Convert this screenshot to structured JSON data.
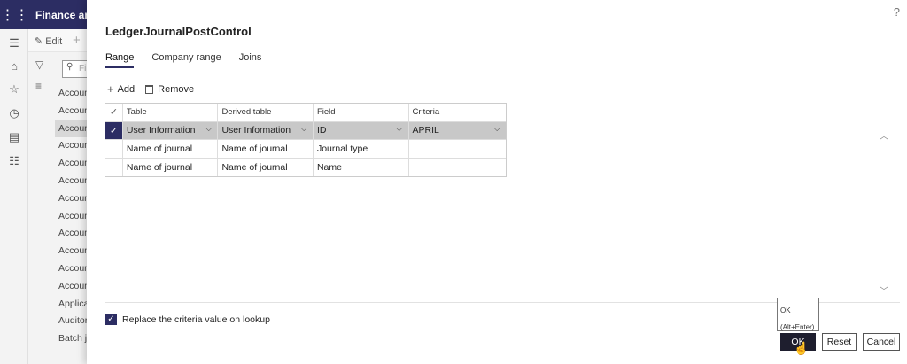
{
  "app": {
    "title": "Finance and"
  },
  "background": {
    "edit_label": "Edit",
    "filter_placeholder": "Fi",
    "list_items": [
      "Account",
      "Account",
      "Account",
      "Account",
      "Account",
      "Account",
      "Account",
      "Account",
      "Account",
      "Account",
      "Account",
      "Account",
      "Applica",
      "Auditor",
      "Batch jo"
    ]
  },
  "dialog": {
    "title": "LedgerJournalPostControl",
    "help": "?",
    "tabs": [
      "Range",
      "Company range",
      "Joins"
    ],
    "toolbar": {
      "add_label": "Add",
      "remove_label": "Remove"
    },
    "grid": {
      "headers": [
        "Table",
        "Derived table",
        "Field",
        "Criteria"
      ],
      "rows": [
        {
          "table": "User Information",
          "derived": "User Information",
          "field": "ID",
          "criteria": "APRIL"
        },
        {
          "table": "Name of journal",
          "derived": "Name of journal",
          "field": "Journal type",
          "criteria": ""
        },
        {
          "table": "Name of journal",
          "derived": "Name of journal",
          "field": "Name",
          "criteria": ""
        }
      ]
    },
    "lookup_checkbox_label": "Replace the criteria value on lookup",
    "tooltip": {
      "line1": "OK",
      "line2": "(Alt+Enter)"
    },
    "buttons": {
      "ok": "OK",
      "reset": "Reset",
      "cancel": "Cancel"
    }
  },
  "colors": {
    "brand": "#2c2d63",
    "selected_row": "#c8c8c8"
  }
}
